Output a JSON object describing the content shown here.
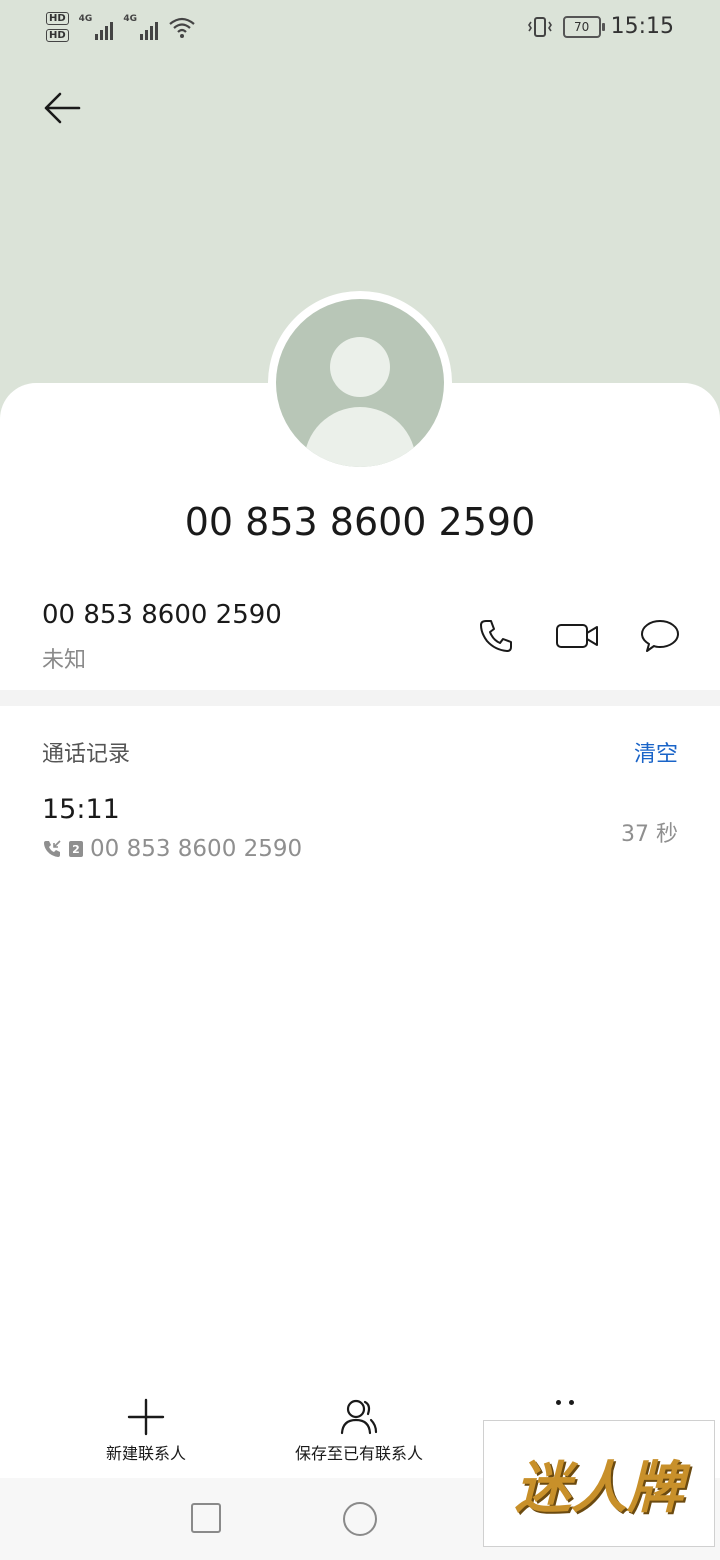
{
  "status_bar": {
    "hd1": "HD",
    "hd2": "HD",
    "network1": "4G",
    "network2": "4G",
    "battery_level": "70",
    "time": "15:15"
  },
  "contact": {
    "number": "00 853 8600 2590",
    "number_display": "00 853 8600 2590",
    "location": "未知"
  },
  "call_log": {
    "title": "通话记录",
    "clear_label": "清空",
    "entries": [
      {
        "time": "15:11",
        "sim": "2",
        "number": "00 853 8600 2590",
        "duration": "37 秒"
      }
    ]
  },
  "bottom_actions": {
    "new_contact_label": "新建联系人",
    "save_existing_label": "保存至已有联系人"
  },
  "watermark": {
    "text": "迷人牌"
  },
  "colors": {
    "header_bg": "#dbe3d8",
    "avatar_bg": "#b8c6b7",
    "accent": "#1a64c8"
  }
}
